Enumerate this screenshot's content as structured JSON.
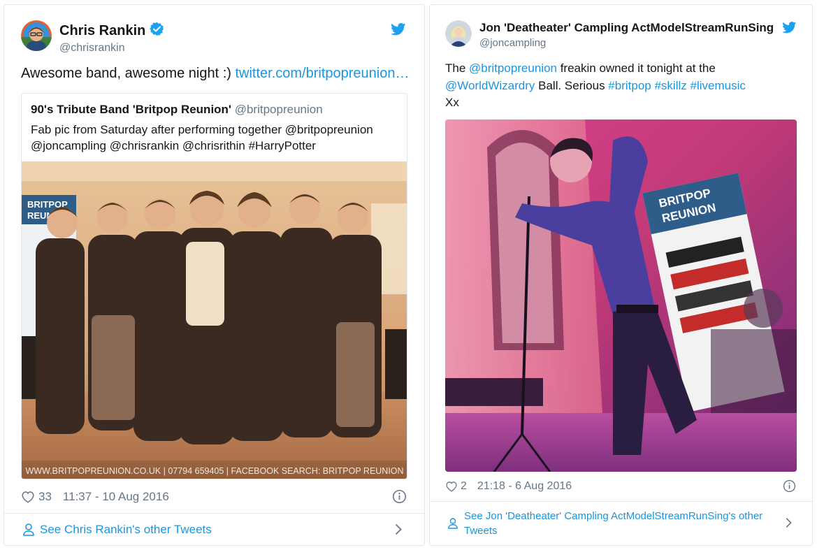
{
  "tweets": [
    {
      "author_name": "Chris Rankin",
      "author_handle": "@chrisrankin",
      "verified": true,
      "text_plain": "Awesome band, awesome night :) ",
      "text_link": "twitter.com/britpopreunion…",
      "quoted": {
        "author_name": "90's Tribute Band 'Britpop Reunion'",
        "author_handle": "@britpopreunion",
        "line1": "Fab pic from Saturday after performing together @britpopreunion",
        "line2": "@joncampling @chrisrankin @chrisrithin #HarryPotter",
        "photo_caption": "WWW.BRITPOPREUNION.CO.UK | 07794 659405 | FACEBOOK SEARCH: BRITPOP REUNION",
        "banner_text_1": "BRITPOP",
        "banner_text_2": "REUNION"
      },
      "likes": "33",
      "timestamp": "11:37 - 10 Aug 2016",
      "footer_link": "See Chris Rankin's other Tweets"
    },
    {
      "author_name": "Jon 'Deatheater' Campling ActModelStreamRunSing",
      "author_handle": "@joncampling",
      "verified": false,
      "text_parts": {
        "p1": "The ",
        "m1": "@britpopreunion",
        "p2": " freakin owned it tonight at the",
        "m2": "@WorldWizardry",
        "p3": " Ball. Serious ",
        "h1": "#britpop",
        "h2": "#skillz",
        "h3": "#livemusic",
        "p4": "Xx"
      },
      "banner_text_1": "BRITPOP",
      "banner_text_2": "REUNION",
      "likes": "2",
      "timestamp": "21:18 - 6 Aug 2016",
      "footer_link_line1": "See Jon 'Deatheater' Campling ActModelStreamRunSing's other",
      "footer_link_line2": "Tweets"
    }
  ],
  "colors": {
    "link": "#1b95e0",
    "muted": "#657786",
    "border": "#e1e8ed",
    "verified": "#1da1f2"
  },
  "icons": {
    "bird": "twitter-bird-icon",
    "verified": "verified-badge-icon",
    "heart": "heart-icon",
    "info": "info-icon",
    "person": "person-icon",
    "chevron": "chevron-right-icon"
  }
}
